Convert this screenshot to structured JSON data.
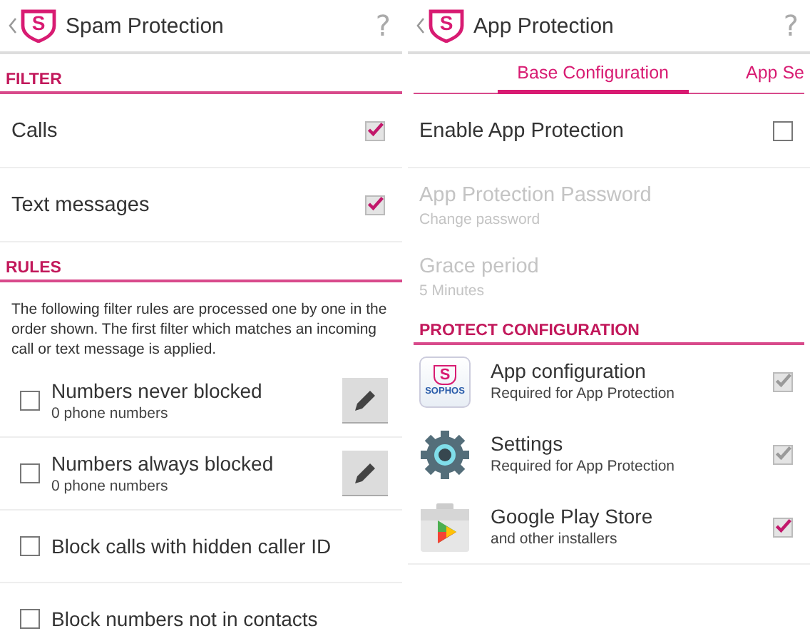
{
  "left": {
    "header": {
      "title": "Spam Protection",
      "logo_letter": "S",
      "help": "?"
    },
    "filter": {
      "heading": "FILTER",
      "items": [
        {
          "label": "Calls",
          "checked": true
        },
        {
          "label": "Text messages",
          "checked": true
        }
      ]
    },
    "rules": {
      "heading": "RULES",
      "description": "The following filter rules are processed one by one in the order shown. The first filter which matches an incoming call or text message is applied.",
      "items": [
        {
          "label": "Numbers never blocked",
          "detail": "0 phone numbers",
          "checked": false,
          "editable": true
        },
        {
          "label": "Numbers always blocked",
          "detail": "0 phone numbers",
          "checked": false,
          "editable": true
        },
        {
          "label": "Block calls with hidden caller ID",
          "checked": false,
          "editable": false
        },
        {
          "label": "Block numbers not in contacts",
          "checked": false,
          "editable": false
        }
      ]
    }
  },
  "right": {
    "header": {
      "title": "App Protection",
      "logo_letter": "S",
      "help": "?"
    },
    "tabs": [
      {
        "label": "Base Configuration",
        "selected": true
      },
      {
        "label": "App Se",
        "selected": false
      }
    ],
    "settings": [
      {
        "kind": "checkbox",
        "label": "Enable App Protection",
        "checked": false,
        "disabled": false
      },
      {
        "kind": "text",
        "label": "App Protection Password",
        "detail": "Change password",
        "disabled": true
      },
      {
        "kind": "text",
        "label": "Grace period",
        "detail": "5 Minutes",
        "disabled": true
      }
    ],
    "protect": {
      "heading": "PROTECT CONFIGURATION",
      "apps": [
        {
          "kind": "sophos",
          "icon_letter": "S",
          "icon_text": "SOPHOS",
          "label": "App configuration",
          "detail": "Required for App Protection",
          "checked": true,
          "disabled": true
        },
        {
          "kind": "gear",
          "label": "Settings",
          "detail": "Required for App Protection",
          "checked": true,
          "disabled": true
        },
        {
          "kind": "store",
          "label": "Google Play Store",
          "detail": "and other installers",
          "checked": true,
          "disabled": false
        }
      ]
    }
  }
}
